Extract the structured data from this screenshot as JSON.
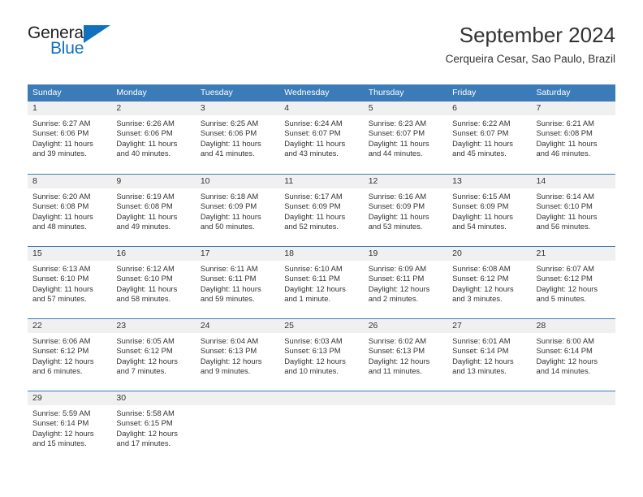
{
  "logo": {
    "primary_text": "General",
    "secondary_text": "Blue",
    "triangle_icon": "triangle-icon",
    "brand_blue": "#1271bd",
    "brand_dark": "#231f20"
  },
  "header": {
    "title": "September 2024",
    "subtitle": "Cerqueira Cesar, Sao Paulo, Brazil"
  },
  "theme": {
    "header_blue": "#3b7cb8",
    "day_number_bg": "#f0f0f0",
    "text": "#333333"
  },
  "calendar": {
    "weekdays": [
      "Sunday",
      "Monday",
      "Tuesday",
      "Wednesday",
      "Thursday",
      "Friday",
      "Saturday"
    ],
    "weeks": [
      [
        {
          "day": "1",
          "sunrise": "Sunrise: 6:27 AM",
          "sunset": "Sunset: 6:06 PM",
          "daylight_line1": "Daylight: 11 hours",
          "daylight_line2": "and 39 minutes."
        },
        {
          "day": "2",
          "sunrise": "Sunrise: 6:26 AM",
          "sunset": "Sunset: 6:06 PM",
          "daylight_line1": "Daylight: 11 hours",
          "daylight_line2": "and 40 minutes."
        },
        {
          "day": "3",
          "sunrise": "Sunrise: 6:25 AM",
          "sunset": "Sunset: 6:06 PM",
          "daylight_line1": "Daylight: 11 hours",
          "daylight_line2": "and 41 minutes."
        },
        {
          "day": "4",
          "sunrise": "Sunrise: 6:24 AM",
          "sunset": "Sunset: 6:07 PM",
          "daylight_line1": "Daylight: 11 hours",
          "daylight_line2": "and 43 minutes."
        },
        {
          "day": "5",
          "sunrise": "Sunrise: 6:23 AM",
          "sunset": "Sunset: 6:07 PM",
          "daylight_line1": "Daylight: 11 hours",
          "daylight_line2": "and 44 minutes."
        },
        {
          "day": "6",
          "sunrise": "Sunrise: 6:22 AM",
          "sunset": "Sunset: 6:07 PM",
          "daylight_line1": "Daylight: 11 hours",
          "daylight_line2": "and 45 minutes."
        },
        {
          "day": "7",
          "sunrise": "Sunrise: 6:21 AM",
          "sunset": "Sunset: 6:08 PM",
          "daylight_line1": "Daylight: 11 hours",
          "daylight_line2": "and 46 minutes."
        }
      ],
      [
        {
          "day": "8",
          "sunrise": "Sunrise: 6:20 AM",
          "sunset": "Sunset: 6:08 PM",
          "daylight_line1": "Daylight: 11 hours",
          "daylight_line2": "and 48 minutes."
        },
        {
          "day": "9",
          "sunrise": "Sunrise: 6:19 AM",
          "sunset": "Sunset: 6:08 PM",
          "daylight_line1": "Daylight: 11 hours",
          "daylight_line2": "and 49 minutes."
        },
        {
          "day": "10",
          "sunrise": "Sunrise: 6:18 AM",
          "sunset": "Sunset: 6:09 PM",
          "daylight_line1": "Daylight: 11 hours",
          "daylight_line2": "and 50 minutes."
        },
        {
          "day": "11",
          "sunrise": "Sunrise: 6:17 AM",
          "sunset": "Sunset: 6:09 PM",
          "daylight_line1": "Daylight: 11 hours",
          "daylight_line2": "and 52 minutes."
        },
        {
          "day": "12",
          "sunrise": "Sunrise: 6:16 AM",
          "sunset": "Sunset: 6:09 PM",
          "daylight_line1": "Daylight: 11 hours",
          "daylight_line2": "and 53 minutes."
        },
        {
          "day": "13",
          "sunrise": "Sunrise: 6:15 AM",
          "sunset": "Sunset: 6:09 PM",
          "daylight_line1": "Daylight: 11 hours",
          "daylight_line2": "and 54 minutes."
        },
        {
          "day": "14",
          "sunrise": "Sunrise: 6:14 AM",
          "sunset": "Sunset: 6:10 PM",
          "daylight_line1": "Daylight: 11 hours",
          "daylight_line2": "and 56 minutes."
        }
      ],
      [
        {
          "day": "15",
          "sunrise": "Sunrise: 6:13 AM",
          "sunset": "Sunset: 6:10 PM",
          "daylight_line1": "Daylight: 11 hours",
          "daylight_line2": "and 57 minutes."
        },
        {
          "day": "16",
          "sunrise": "Sunrise: 6:12 AM",
          "sunset": "Sunset: 6:10 PM",
          "daylight_line1": "Daylight: 11 hours",
          "daylight_line2": "and 58 minutes."
        },
        {
          "day": "17",
          "sunrise": "Sunrise: 6:11 AM",
          "sunset": "Sunset: 6:11 PM",
          "daylight_line1": "Daylight: 11 hours",
          "daylight_line2": "and 59 minutes."
        },
        {
          "day": "18",
          "sunrise": "Sunrise: 6:10 AM",
          "sunset": "Sunset: 6:11 PM",
          "daylight_line1": "Daylight: 12 hours",
          "daylight_line2": "and 1 minute."
        },
        {
          "day": "19",
          "sunrise": "Sunrise: 6:09 AM",
          "sunset": "Sunset: 6:11 PM",
          "daylight_line1": "Daylight: 12 hours",
          "daylight_line2": "and 2 minutes."
        },
        {
          "day": "20",
          "sunrise": "Sunrise: 6:08 AM",
          "sunset": "Sunset: 6:12 PM",
          "daylight_line1": "Daylight: 12 hours",
          "daylight_line2": "and 3 minutes."
        },
        {
          "day": "21",
          "sunrise": "Sunrise: 6:07 AM",
          "sunset": "Sunset: 6:12 PM",
          "daylight_line1": "Daylight: 12 hours",
          "daylight_line2": "and 5 minutes."
        }
      ],
      [
        {
          "day": "22",
          "sunrise": "Sunrise: 6:06 AM",
          "sunset": "Sunset: 6:12 PM",
          "daylight_line1": "Daylight: 12 hours",
          "daylight_line2": "and 6 minutes."
        },
        {
          "day": "23",
          "sunrise": "Sunrise: 6:05 AM",
          "sunset": "Sunset: 6:12 PM",
          "daylight_line1": "Daylight: 12 hours",
          "daylight_line2": "and 7 minutes."
        },
        {
          "day": "24",
          "sunrise": "Sunrise: 6:04 AM",
          "sunset": "Sunset: 6:13 PM",
          "daylight_line1": "Daylight: 12 hours",
          "daylight_line2": "and 9 minutes."
        },
        {
          "day": "25",
          "sunrise": "Sunrise: 6:03 AM",
          "sunset": "Sunset: 6:13 PM",
          "daylight_line1": "Daylight: 12 hours",
          "daylight_line2": "and 10 minutes."
        },
        {
          "day": "26",
          "sunrise": "Sunrise: 6:02 AM",
          "sunset": "Sunset: 6:13 PM",
          "daylight_line1": "Daylight: 12 hours",
          "daylight_line2": "and 11 minutes."
        },
        {
          "day": "27",
          "sunrise": "Sunrise: 6:01 AM",
          "sunset": "Sunset: 6:14 PM",
          "daylight_line1": "Daylight: 12 hours",
          "daylight_line2": "and 13 minutes."
        },
        {
          "day": "28",
          "sunrise": "Sunrise: 6:00 AM",
          "sunset": "Sunset: 6:14 PM",
          "daylight_line1": "Daylight: 12 hours",
          "daylight_line2": "and 14 minutes."
        }
      ],
      [
        {
          "day": "29",
          "sunrise": "Sunrise: 5:59 AM",
          "sunset": "Sunset: 6:14 PM",
          "daylight_line1": "Daylight: 12 hours",
          "daylight_line2": "and 15 minutes."
        },
        {
          "day": "30",
          "sunrise": "Sunrise: 5:58 AM",
          "sunset": "Sunset: 6:15 PM",
          "daylight_line1": "Daylight: 12 hours",
          "daylight_line2": "and 17 minutes."
        },
        {
          "day": "",
          "sunrise": "",
          "sunset": "",
          "daylight_line1": "",
          "daylight_line2": ""
        },
        {
          "day": "",
          "sunrise": "",
          "sunset": "",
          "daylight_line1": "",
          "daylight_line2": ""
        },
        {
          "day": "",
          "sunrise": "",
          "sunset": "",
          "daylight_line1": "",
          "daylight_line2": ""
        },
        {
          "day": "",
          "sunrise": "",
          "sunset": "",
          "daylight_line1": "",
          "daylight_line2": ""
        },
        {
          "day": "",
          "sunrise": "",
          "sunset": "",
          "daylight_line1": "",
          "daylight_line2": ""
        }
      ]
    ]
  }
}
